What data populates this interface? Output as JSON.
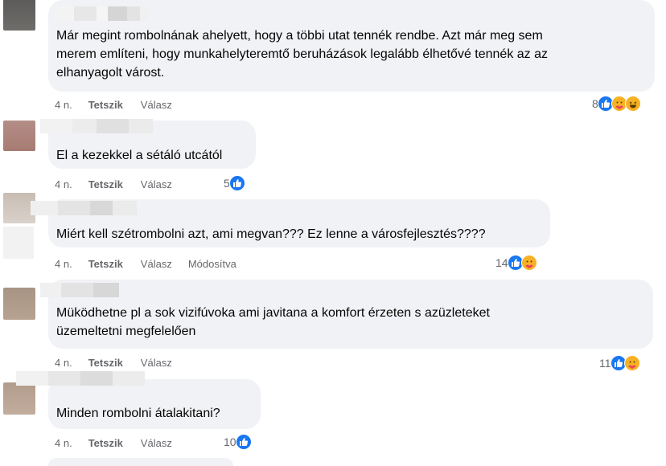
{
  "comments": [
    {
      "text": "Már megint rombolnának ahelyett, hogy a többi utat tennék rendbe. Azt már meg sem\nmerem említeni, hogy munkahelyteremtő beruházások legalább élhetővé tennék az az\nelhanyagolt várost.",
      "age": "4 n.",
      "like_label": "Tetszik",
      "reply_label": "Válasz",
      "reaction_count": "8",
      "reaction_icons": [
        "like-icon",
        "care-icon",
        "haha-icon"
      ]
    },
    {
      "text": "El a kezekkel a sétáló utcától",
      "age": "4 n.",
      "like_label": "Tetszik",
      "reply_label": "Válasz",
      "reaction_count": "5",
      "reaction_icons": [
        "like-icon"
      ]
    },
    {
      "text": "Miért kell szétrombolni azt, ami megvan??? Ez lenne a városfejlesztés????",
      "age": "4 n.",
      "like_label": "Tetszik",
      "reply_label": "Válasz",
      "edited_label": "Módosítva",
      "reaction_count": "14",
      "reaction_icons": [
        "like-icon",
        "care-icon"
      ]
    },
    {
      "text": "Müködhetne pl a sok vizifúvoka ami javitana a komfort érzeten s azüzleteket\nüzemeltetni megfelelően",
      "age": "4 n.",
      "like_label": "Tetszik",
      "reply_label": "Válasz",
      "reaction_count": "11",
      "reaction_icons": [
        "like-icon",
        "care-icon"
      ]
    },
    {
      "text": "Minden rombolni átalakitani?",
      "age": "4 n.",
      "like_label": "Tetszik",
      "reply_label": "Válasz",
      "reaction_count": "10",
      "reaction_icons": [
        "like-icon"
      ]
    }
  ],
  "colors": {
    "like": "#1877f2",
    "care": "#f7b125",
    "bubble": "#f0f2f5",
    "meta_text": "#65676b"
  }
}
